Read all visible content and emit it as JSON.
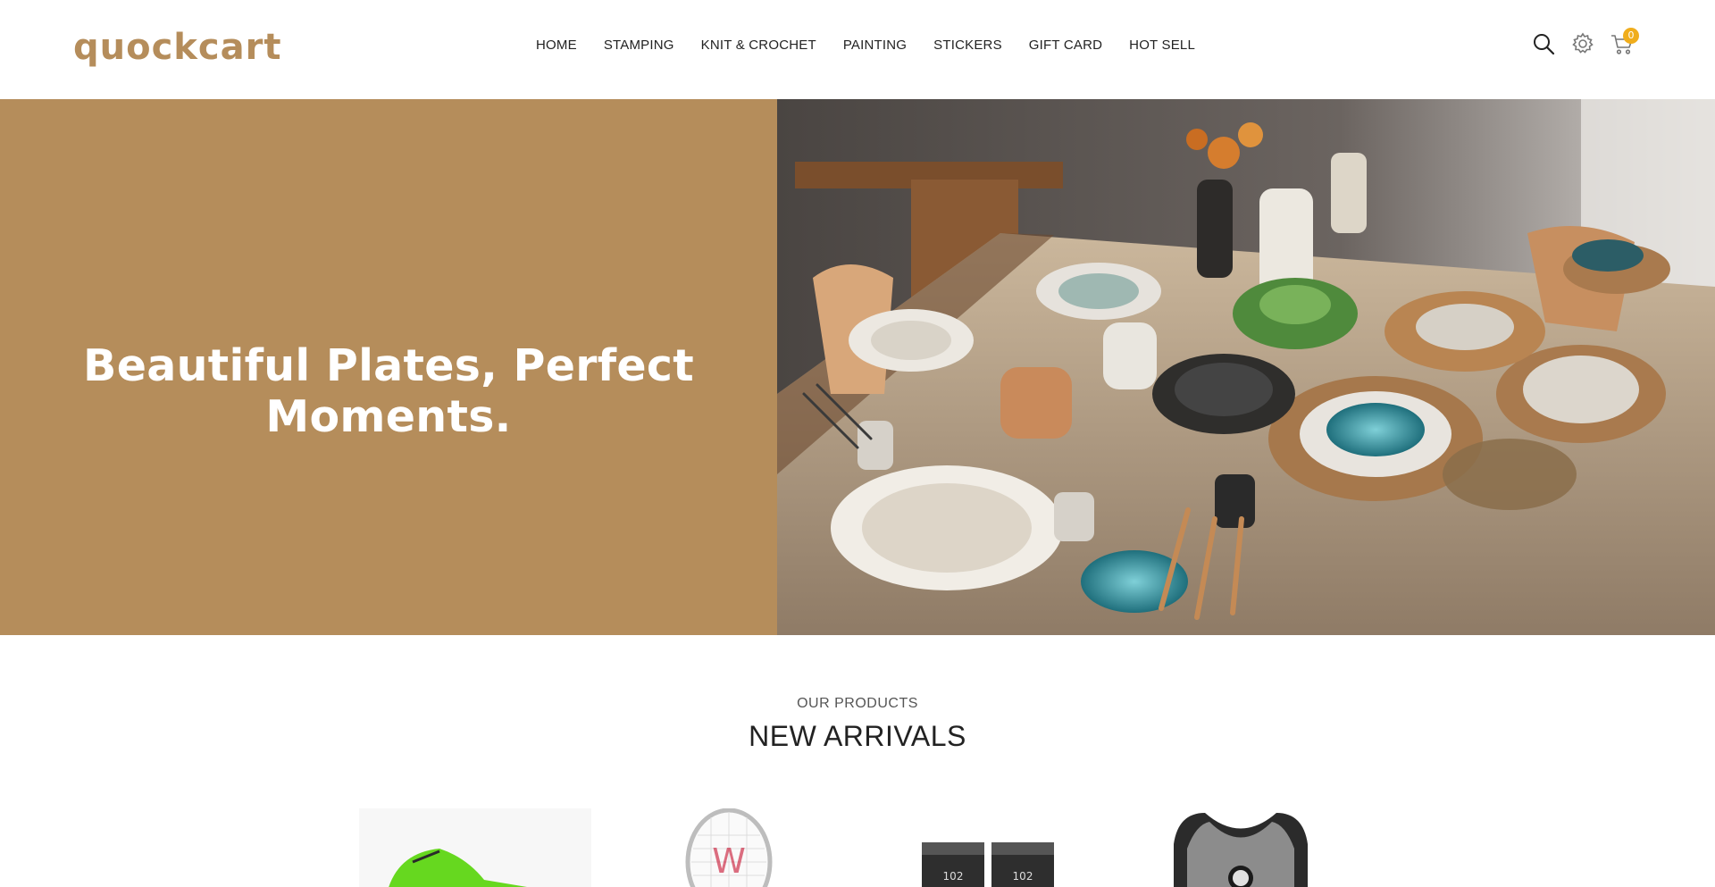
{
  "brand": {
    "logo_text": "quockcart",
    "color": "#b58d5b"
  },
  "nav": {
    "items": [
      {
        "label": "HOME"
      },
      {
        "label": "STAMPING"
      },
      {
        "label": "KNIT & CROCHET"
      },
      {
        "label": "PAINTING"
      },
      {
        "label": "STICKERS"
      },
      {
        "label": "GIFT CARD"
      },
      {
        "label": "HOT SELL"
      }
    ]
  },
  "header_icons": {
    "search": "search-icon",
    "settings": "gear-icon",
    "cart": "cart-icon",
    "cart_count": "0",
    "badge_color": "#f0ad1c"
  },
  "hero": {
    "title": "Beautiful Plates, Perfect Moments.",
    "bg_color": "#b58d5b",
    "image": "table-setting-photo"
  },
  "section": {
    "subtitle": "OUR PRODUCTS",
    "title": "NEW ARRIVALS"
  },
  "products": [
    {
      "image": "green-sneaker"
    },
    {
      "image": "tennis-racket"
    },
    {
      "image": "black-gloves"
    },
    {
      "image": "raiders-tank-top"
    }
  ]
}
